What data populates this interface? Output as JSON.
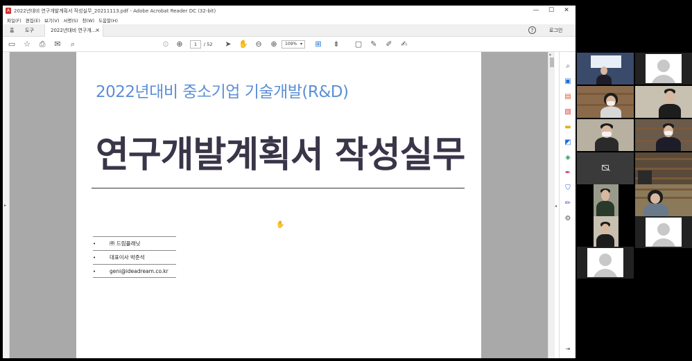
{
  "window": {
    "title": "2022년대비 연구개발계획서 작성실무_20211113.pdf - Adobe Acrobat Reader DC (32-bit)",
    "minimize": "—",
    "maximize": "☐",
    "close": "✕"
  },
  "menu": [
    "파일(F)",
    "편집(E)",
    "보기(V)",
    "서명(S)",
    "창(W)",
    "도움말(H)"
  ],
  "tabs": {
    "home": "홈",
    "tools": "도구",
    "document": "2022년대비 연구개...",
    "close": "×",
    "help": "?",
    "login": "로그인"
  },
  "toolbar": {
    "current_page": "1",
    "total_pages": "/ 52",
    "zoom": "109%"
  },
  "document": {
    "subtitle": "2022년대비 중소기업 기술개발(R&D)",
    "title": "연구개발계획서 작성실무",
    "info": [
      {
        "bullet": "•",
        "text": "㈜ 드림플래닛"
      },
      {
        "bullet": "•",
        "text": "대표이사 박준석"
      },
      {
        "bullet": "•",
        "text": "geni@ideadream.co.kr"
      }
    ]
  },
  "colors": {
    "subtitle": "#5b8fd6",
    "title": "#3a3548",
    "page_background": "#a9a9a9",
    "acrobat_red": "#d32f2f"
  },
  "icons": {
    "toolbar_left": [
      "save-icon",
      "bookmark-star-icon",
      "print-icon",
      "email-icon",
      "search-icon"
    ],
    "toolbar_center": [
      "page-up-icon",
      "page-down-icon",
      "select-cursor-icon",
      "hand-tool-icon",
      "zoom-out-icon",
      "zoom-in-icon",
      "fit-page-icon",
      "scroll-mode-icon"
    ],
    "toolbar_right": [
      "comment-icon",
      "highlight-pen-icon",
      "draw-icon",
      "sign-icon"
    ],
    "tools_pane": [
      "zoom-search-icon",
      "create-pdf-icon",
      "organize-pages-icon",
      "export-pdf-icon",
      "comment-tool-icon",
      "edit-pdf-icon",
      "enhance-scan-icon",
      "fill-sign-icon",
      "protect-icon",
      "draw-pen-icon",
      "more-tools-icon"
    ]
  },
  "gallery": {
    "participant_count": 14
  }
}
